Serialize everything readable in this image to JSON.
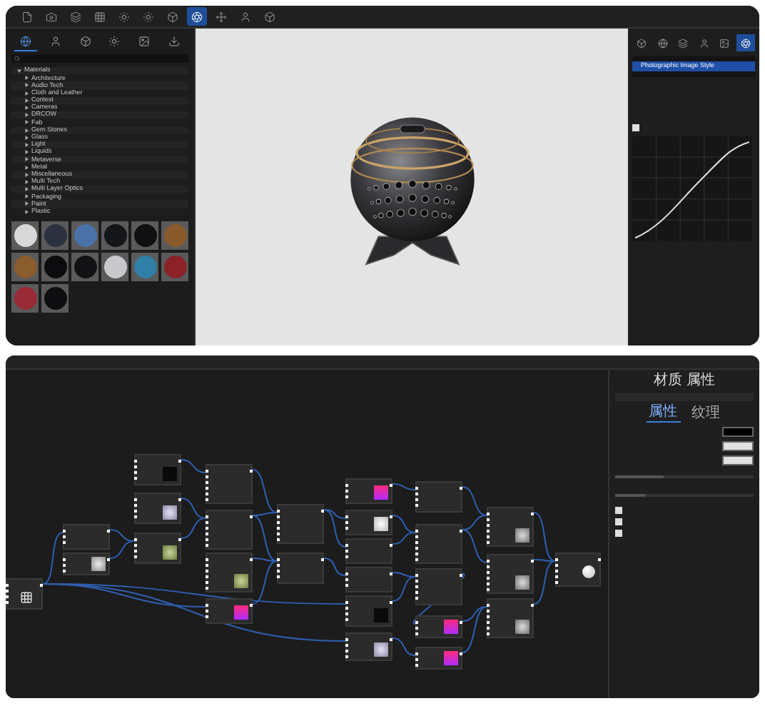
{
  "toolbar": {
    "items": [
      {
        "selected": false
      },
      {
        "selected": false
      },
      {
        "selected": false
      },
      {
        "selected": false
      },
      {
        "selected": false
      },
      {
        "selected": false
      },
      {
        "selected": false
      },
      {
        "selected": true
      },
      {
        "selected": false
      },
      {
        "selected": false
      },
      {
        "selected": false
      }
    ]
  },
  "library": {
    "tabs": [
      {
        "selected": true
      },
      {
        "selected": false
      },
      {
        "selected": false
      },
      {
        "selected": false
      },
      {
        "selected": false
      },
      {
        "selected": false
      }
    ],
    "tree": [
      {
        "label": "Materials",
        "expanded": true,
        "children": [
          {
            "label": "Architecture",
            "expanded": false
          },
          {
            "label": "Audio Tech",
            "expanded": false
          },
          {
            "label": "Cloth and Leather",
            "expanded": false
          },
          {
            "label": "Contest",
            "expanded": false
          },
          {
            "label": "Cameras",
            "expanded": false
          },
          {
            "label": "DRCOW",
            "expanded": false
          },
          {
            "label": "Fab",
            "expanded": false
          },
          {
            "label": "Gem Stones",
            "expanded": false
          },
          {
            "label": "Glass",
            "expanded": false
          },
          {
            "label": "Light",
            "expanded": false
          },
          {
            "label": "Liquids",
            "expanded": false
          },
          {
            "label": "Metaverse",
            "expanded": false
          },
          {
            "label": "Metal",
            "expanded": false
          },
          {
            "label": "Miscellaneous",
            "expanded": false
          },
          {
            "label": "Multi Tech",
            "expanded": false
          },
          {
            "label": "Multi Layer Optics",
            "expanded": false
          },
          {
            "label": "Packaging",
            "expanded": false
          },
          {
            "label": "Paint",
            "expanded": false
          },
          {
            "label": "Plastic",
            "expanded": false
          }
        ]
      }
    ],
    "swatches": [
      {
        "color": "#d8d8d8"
      },
      {
        "color": "#2c3140"
      },
      {
        "color": "#4a72a8"
      },
      {
        "color": "#15161a"
      },
      {
        "color": "#101012"
      },
      {
        "color": "#8a5a2c"
      },
      {
        "color": "#8a5c2e"
      },
      {
        "color": "#0c0c0e"
      },
      {
        "color": "#121214"
      },
      {
        "color": "#c8c8cc"
      },
      {
        "color": "#2f7fa6"
      },
      {
        "color": "#8a2228"
      },
      {
        "color": "#9a2a36"
      },
      {
        "color": "#0e0e10"
      }
    ]
  },
  "layers": {
    "tabs": [
      {
        "selected": false
      },
      {
        "selected": false
      },
      {
        "selected": false
      },
      {
        "selected": false
      },
      {
        "selected": false
      },
      {
        "selected": true
      }
    ],
    "items": [
      {
        "label": "Photographic Image Style",
        "selected": true
      }
    ],
    "curve_enabled": {
      "checked": true
    }
  },
  "graph": {
    "nodes": [
      {
        "kind": "grid"
      },
      {
        "kind": "plain"
      },
      {
        "kind": "noise"
      },
      {
        "kind": "dark"
      },
      {
        "kind": "lavender"
      },
      {
        "kind": "green"
      },
      {
        "kind": "plain"
      },
      {
        "kind": "plain"
      },
      {
        "kind": "green"
      },
      {
        "kind": "magenta"
      },
      {
        "kind": "plain"
      },
      {
        "kind": "plain"
      },
      {
        "kind": "magenta"
      },
      {
        "kind": "white"
      },
      {
        "kind": "plain"
      },
      {
        "kind": "plain"
      },
      {
        "kind": "dark"
      },
      {
        "kind": "lavender"
      },
      {
        "kind": "plain"
      },
      {
        "kind": "plain"
      },
      {
        "kind": "plain"
      },
      {
        "kind": "magenta"
      },
      {
        "kind": "magenta"
      },
      {
        "kind": "grey"
      },
      {
        "kind": "grey"
      },
      {
        "kind": "grey"
      },
      {
        "kind": "sphere"
      }
    ]
  },
  "properties": {
    "title": "材质 属性",
    "tabs": [
      {
        "label": "属性",
        "selected": true
      },
      {
        "label": "纹理",
        "selected": false
      }
    ],
    "rows": [
      {
        "kind": "color",
        "color": "#000000"
      },
      {
        "kind": "color",
        "color": "#e0e0e0"
      },
      {
        "kind": "color",
        "color": "#e0e0e0"
      },
      {
        "kind": "slider",
        "level": 0.35
      },
      {
        "kind": "slider",
        "level": 0.22
      }
    ],
    "checks": [
      {
        "checked": true
      },
      {
        "checked": true
      },
      {
        "checked": true
      }
    ]
  }
}
